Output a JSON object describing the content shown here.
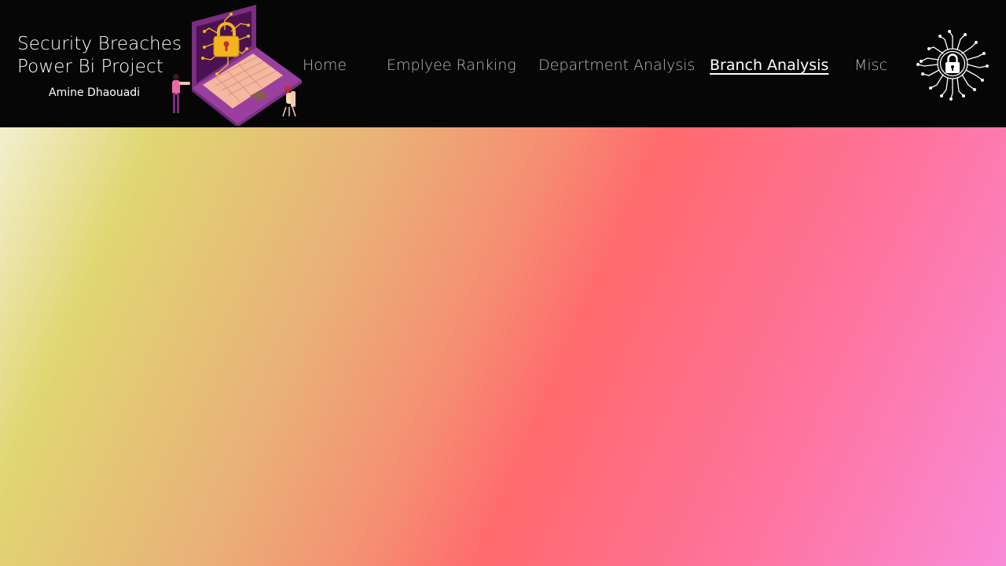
{
  "header": {
    "title_line1": "Security Breaches",
    "title_line2": "Power Bi Project",
    "author": "Amine Dhaouadi"
  },
  "nav": {
    "home": "Home",
    "ranking": "Emplyee Ranking",
    "department": "Department Analysis",
    "branch": "Branch Analysis",
    "misc": "Misc",
    "active": "Branch Analysis"
  },
  "icons": {
    "illustration": "laptop-padlock-illustration",
    "logo": "circuit-padlock-icon"
  },
  "colors": {
    "header_bg": "#060606",
    "nav_text": "#b9b9b9",
    "nav_active": "#ffffff",
    "gradient_stops": [
      "#f3efcf",
      "#e0d672",
      "#e9b278",
      "#f58f72",
      "#ff6b6e",
      "#ff729a",
      "#f98bd8"
    ]
  }
}
